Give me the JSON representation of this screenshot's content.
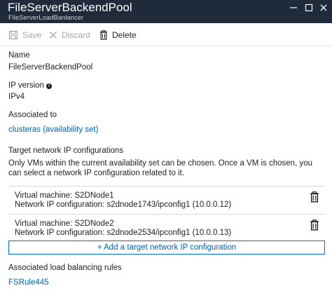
{
  "header": {
    "title": "FileServerBackendPool",
    "subtitle": "FileServerLoadBanlancer"
  },
  "toolbar": {
    "save_label": "Save",
    "discard_label": "Discard",
    "delete_label": "Delete"
  },
  "form": {
    "name_label": "Name",
    "name_value": "FileServerBackendPool",
    "ip_version_label": "IP version",
    "ip_version_value": "IPv4",
    "associated_to_label": "Associated to",
    "associated_to_value": "clusteras (availability set)",
    "target_label": "Target network IP configurations",
    "target_description": "Only VMs within the current availability set can be chosen. Once a VM is chosen, you can select a network IP configuration related to it.",
    "ip_configs": [
      {
        "vm": "Virtual machine: S2DNode1",
        "config": "Network IP configuration: s2dnode1743/ipconfig1 (10.0.0.12)"
      },
      {
        "vm": "Virtual machine: S2DNode2",
        "config": "Network IP configuration: s2dnode2534/ipconfig1 (10.0.0.13)"
      }
    ],
    "add_button_label": "+ Add a target network IP configuration",
    "lb_rules_label": "Associated load balancing rules",
    "lb_rule_value": "FSRule445"
  },
  "icons": {
    "save": "save-icon",
    "discard": "discard-x-icon",
    "delete": "trash-icon",
    "info": "info-icon"
  },
  "colors": {
    "header_bg": "#1f2b3a",
    "link": "#0063b1",
    "disabled": "#a6a6a6",
    "accent_border": "#0072c6"
  }
}
